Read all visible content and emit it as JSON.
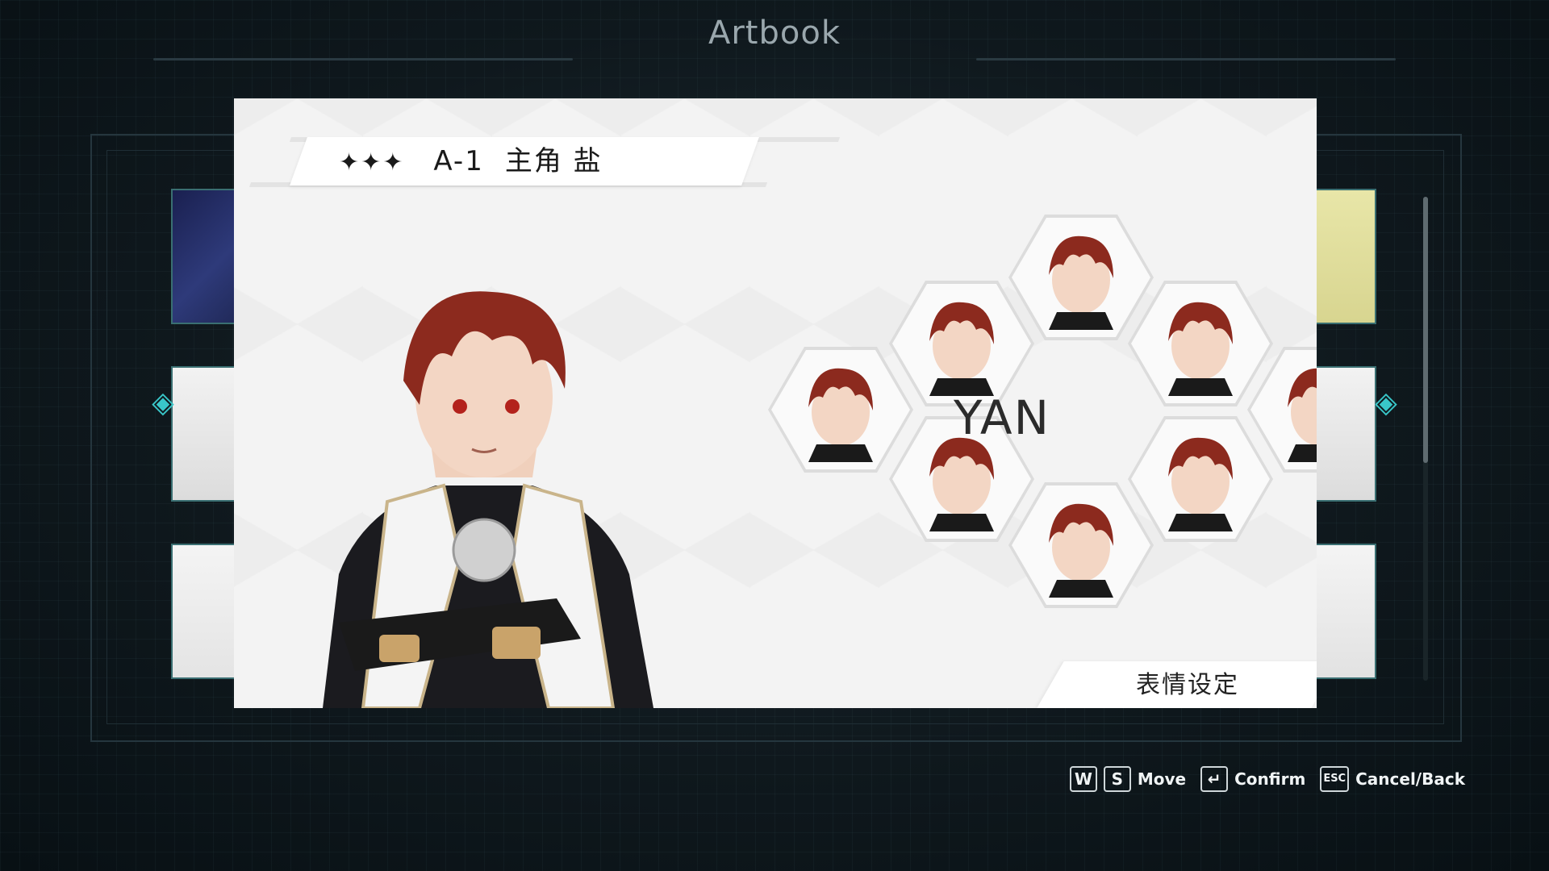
{
  "header": {
    "title": "Artbook"
  },
  "card": {
    "stars": "✦✦✦",
    "code": "A-1",
    "name_label": "主角 盐",
    "character_name": "YAN",
    "caption": "表情设定"
  },
  "controls": {
    "move_keys": [
      "W",
      "S"
    ],
    "move_label": "Move",
    "confirm_key": "↵",
    "confirm_label": "Confirm",
    "back_key": "ESC",
    "back_label": "Cancel/Back"
  },
  "colors": {
    "accent": "#39c7c9",
    "hair": "#8c2a1e",
    "frame": "#3a6f72"
  },
  "thumbnails_left": [
    "thumb-starmap",
    "thumb-character-sheet",
    "thumb-sketch"
  ],
  "thumbnails_right": [
    "thumb-faces",
    "thumb-character-sheet",
    "thumb-sketch"
  ]
}
